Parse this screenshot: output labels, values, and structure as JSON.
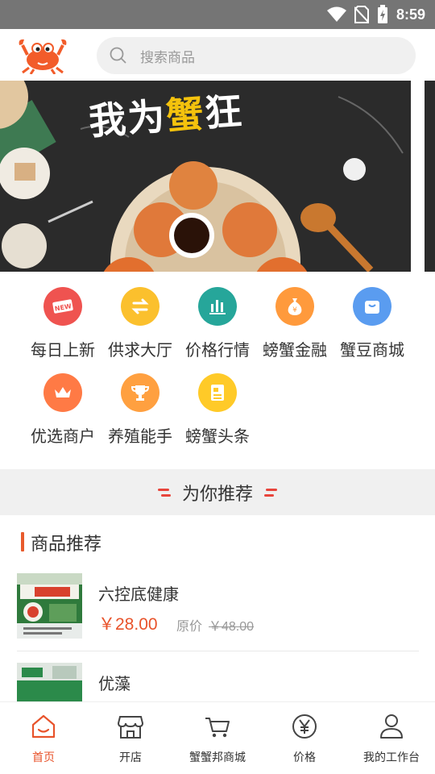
{
  "status": {
    "time": "8:59"
  },
  "search": {
    "placeholder": "搜索商品"
  },
  "banner": {
    "title_left": "我为",
    "title_highlight": "蟹",
    "title_right": "狂"
  },
  "quick_menu": [
    {
      "label": "每日上新",
      "icon": "new-icon",
      "color": "#ef5350"
    },
    {
      "label": "供求大厅",
      "icon": "exchange-icon",
      "color": "#fbc02d"
    },
    {
      "label": "价格行情",
      "icon": "bar-chart-icon",
      "color": "#26a69a"
    },
    {
      "label": "螃蟹金融",
      "icon": "money-bag-icon",
      "color": "#ff9a3c"
    },
    {
      "label": "蟹豆商城",
      "icon": "shopping-bag-icon",
      "color": "#5a9cf0"
    },
    {
      "label": "优选商户",
      "icon": "crown-icon",
      "color": "#ff7a45"
    },
    {
      "label": "养殖能手",
      "icon": "trophy-icon",
      "color": "#ffa040"
    },
    {
      "label": "螃蟹头条",
      "icon": "news-icon",
      "color": "#ffca28"
    }
  ],
  "recommend": {
    "title": "为你推荐"
  },
  "section": {
    "title": "商品推荐"
  },
  "products": [
    {
      "name": "六控底健康",
      "price": "￥28.00",
      "orig_label": "原价",
      "orig_price": "￥48.00"
    },
    {
      "name": "优藻",
      "price": "",
      "orig_label": "",
      "orig_price": ""
    }
  ],
  "tabs": [
    {
      "label": "首页",
      "icon": "home-icon",
      "active": true
    },
    {
      "label": "开店",
      "icon": "store-icon",
      "active": false
    },
    {
      "label": "蟹蟹邦商城",
      "icon": "cart-icon",
      "active": false
    },
    {
      "label": "价格",
      "icon": "yuan-icon",
      "active": false
    },
    {
      "label": "我的工作台",
      "icon": "user-icon",
      "active": false
    }
  ],
  "colors": {
    "accent": "#e8532b",
    "section_bar": "#e85a2c"
  }
}
